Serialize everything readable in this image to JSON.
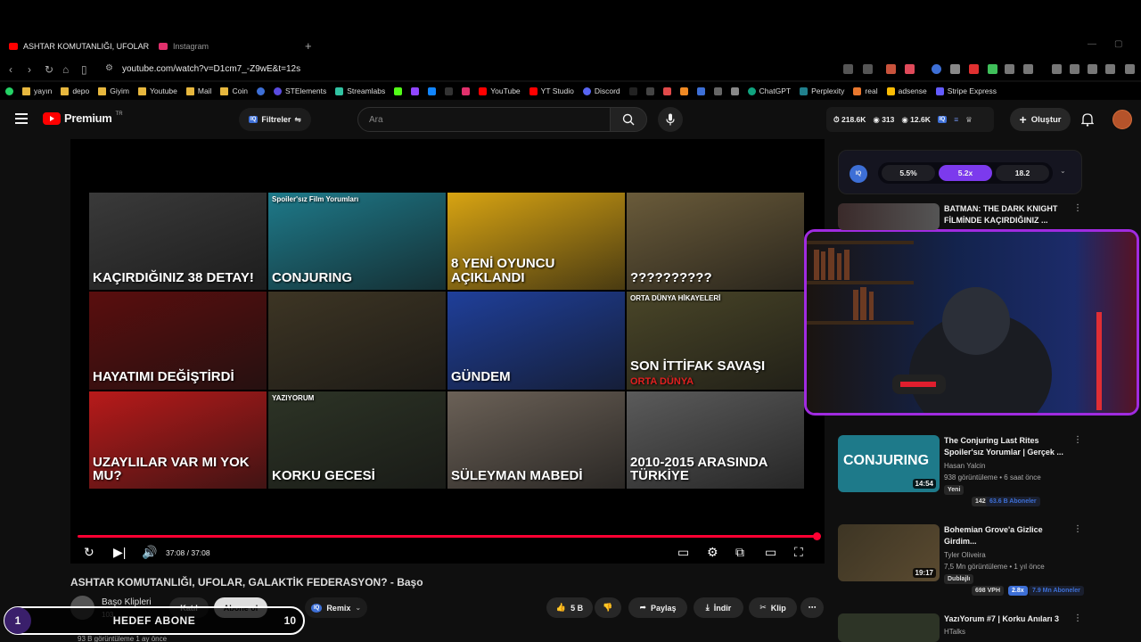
{
  "browser": {
    "tabs": [
      {
        "label": "ASHTAR KOMUTANLIĞI, UFOLAR",
        "active": true
      },
      {
        "label": "Instagram",
        "active": false
      }
    ],
    "url": "youtube.com/watch?v=D1cm7_-Z9wE&t=12s",
    "bookmarks": [
      "yayın",
      "depo",
      "Giyim",
      "Youtube",
      "Mail",
      "Coin",
      "STElements",
      "Streamlabs",
      "YouTube",
      "YT Studio",
      "Discord",
      "ChatGPT",
      "Perplexity",
      "real",
      "adsense",
      "Stripe Express"
    ]
  },
  "header": {
    "logo_text": "Premium",
    "logo_region": "TR",
    "filter_label": "Filtreler",
    "iq_label": "IQ",
    "search_placeholder": "Ara",
    "stats": [
      "218.6K",
      "313",
      "12.6K"
    ],
    "create_label": "Oluştur"
  },
  "player": {
    "grid": [
      {
        "text": "KAÇIRDIĞINIZ 38 DETAY!",
        "bg": "#3a3a3a"
      },
      {
        "text": "CONJURING",
        "small": "Spoiler'sız Film Yorumları",
        "bg": "#1e7a8a"
      },
      {
        "text": "8 YENİ OYUNCU AÇIKLANDI",
        "bg": "#d8a412"
      },
      {
        "text": "??????????",
        "bg": "#6a5b3a"
      },
      {
        "text": "HAYATIMI DEĞİŞTİRDİ",
        "bg": "#5a0e0e"
      },
      {
        "text": "",
        "bg": "#3d3524"
      },
      {
        "text": "GÜNDEM",
        "bg": "#1f3f9a"
      },
      {
        "text": "SON İTTİFAK SAVAŞI",
        "small": "ORTA DÜNYA HİKAYELERİ",
        "bottom": "ORTA DÜNYA",
        "bg": "#4a4628"
      },
      {
        "text": "UZAYLILAR VAR MI YOK MU?",
        "bg": "#b81a1a"
      },
      {
        "text": "KORKU GECESİ",
        "small": "YAZIYORUM",
        "bg": "#2d3426"
      },
      {
        "text": "SÜLEYMAN MABEDİ",
        "bg": "#6b6157"
      },
      {
        "text": "2010-2015 ARASINDA TÜRKİYE",
        "bg": "#5b5b5b"
      }
    ],
    "progress": 1.0,
    "time": "37:08 / 37:08"
  },
  "video": {
    "title": "ASHTAR KOMUTANLIĞI, UFOLAR, GALAKTİK FEDERASYON? - Başo",
    "channel": "Başo Klipleri",
    "subs": "103",
    "katil": "Katıl",
    "subscribe": "Abone ol",
    "remix": "Remix",
    "likes": "5 B",
    "share": "Paylaş",
    "download": "İndir",
    "clip": "Klip",
    "views": "93 B görüntüleme  1 ay önce"
  },
  "goal": {
    "left": "1",
    "label": "HEDEF ABONE",
    "right": "10"
  },
  "iq_panel": {
    "label": "IQ",
    "values": [
      "5.5%",
      "5.2x",
      "18.2"
    ]
  },
  "recommendations": [
    {
      "title": "BATMAN: THE DARK KNIGHT FİLMİNDE KAÇIRDIĞINIZ ...",
      "channel": "",
      "meta": "",
      "duration": ""
    },
    {
      "title": "The Conjuring Last Rites Spoiler'sız Yorumlar | Gerçek ...",
      "channel": "Hasan Yalcin",
      "meta": "938 görüntüleme • 6 saat önce",
      "badge": "Yeni",
      "vph": "142 VPH",
      "subs": "63.6 B Aboneler",
      "duration": "14:54"
    },
    {
      "title": "Bohemian Grove'a Gizlice Girdim...",
      "channel": "Tyler Oliveira",
      "meta": "7,5 Mn görüntüleme • 1 yıl önce",
      "badge": "Dublajlı",
      "vph": "698 VPH",
      "mult": "2.8x",
      "subs": "7.9 Mn Aboneler",
      "duration": "19:17"
    },
    {
      "title": "YazıYorum #7 | Korku Anıları 3",
      "channel": "HTalks",
      "meta": "",
      "duration": ""
    }
  ],
  "colors": {
    "accent": "#ff0033",
    "iq_blue": "#3d6fd6",
    "iq_purple": "#7c3aed",
    "cam_border": "#a02be0"
  }
}
